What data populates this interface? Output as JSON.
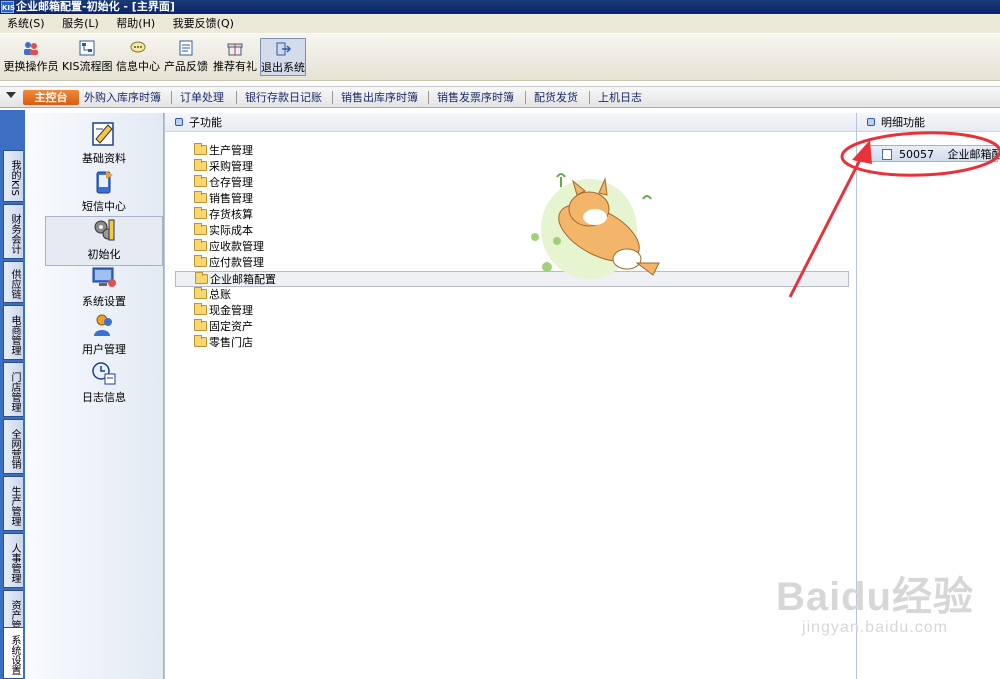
{
  "window": {
    "title": "企业邮箱配置-初始化 - [主界面]",
    "app_icon_text": "KIS"
  },
  "menu": [
    {
      "label": "系统(S)"
    },
    {
      "label": "服务(L)"
    },
    {
      "label": "帮助(H)"
    },
    {
      "label": "我要反馈(Q)"
    }
  ],
  "toolbar": [
    {
      "label": "更换操作员",
      "icon": "switch-user-icon"
    },
    {
      "label": "KIS流程图",
      "icon": "flowchart-icon"
    },
    {
      "label": "信息中心",
      "icon": "message-icon"
    },
    {
      "label": "产品反馈",
      "icon": "feedback-icon"
    },
    {
      "label": "推荐有礼",
      "icon": "gift-icon"
    },
    {
      "label": "退出系统",
      "icon": "exit-icon",
      "active": true
    }
  ],
  "tabs": {
    "home": "主控台",
    "items": [
      "外购入库序时簿",
      "订单处理",
      "银行存款日记账",
      "销售出库序时簿",
      "销售发票序时簿",
      "配货发货",
      "上机日志"
    ]
  },
  "side_tabs": [
    "我的KIS",
    "财务会计",
    "供应链",
    "电商管理",
    "门店管理",
    "全网营销",
    "生产管理",
    "人事管理",
    "资产管理",
    "系统设置"
  ],
  "nav": [
    {
      "label": "基础资料",
      "icon": "basic-data-icon"
    },
    {
      "label": "短信中心",
      "icon": "sms-center-icon"
    },
    {
      "label": "初始化",
      "icon": "initialize-icon",
      "selected": true
    },
    {
      "label": "系统设置",
      "icon": "system-settings-icon"
    },
    {
      "label": "用户管理",
      "icon": "user-management-icon"
    },
    {
      "label": "日志信息",
      "icon": "log-info-icon"
    }
  ],
  "subpanel": {
    "header": "子功能",
    "items": [
      "生产管理",
      "采购管理",
      "仓存管理",
      "销售管理",
      "存货核算",
      "实际成本",
      "应收款管理",
      "应付款管理",
      "企业邮箱配置",
      "总账",
      "现金管理",
      "固定资产",
      "零售门店"
    ],
    "selected": "企业邮箱配置"
  },
  "detail": {
    "header": "明细功能",
    "item": {
      "code": "50057",
      "label": "企业邮箱配置"
    }
  },
  "colors": {
    "title_bar": "#0a246a",
    "side_strip": "#3a6fc4",
    "home_tab": "#e06a1f",
    "annotation": "#e8323a"
  },
  "watermark": {
    "brand": "Baidu经验",
    "url": "jingyan.baidu.com"
  }
}
